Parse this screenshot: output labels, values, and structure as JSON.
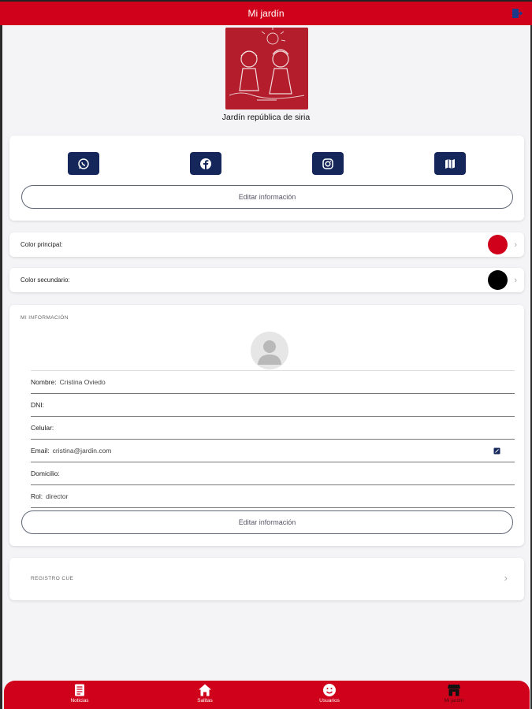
{
  "header": {
    "title": "Mi jardín",
    "logout_icon": "logout-icon"
  },
  "school": {
    "name": "Jardín república de siria",
    "logo_icon": "school-drawing-image"
  },
  "social": {
    "buttons": [
      {
        "icon": "whatsapp-icon"
      },
      {
        "icon": "facebook-icon"
      },
      {
        "icon": "instagram-icon"
      },
      {
        "icon": "map-icon"
      }
    ],
    "edit_label": "Editar información"
  },
  "colors": {
    "primary": {
      "label": "Color principal:",
      "value": "#d0021b"
    },
    "secondary": {
      "label": "Color secundario:",
      "value": "#000000"
    }
  },
  "my_info": {
    "section_label": "Mi información",
    "fields": [
      {
        "label": "Nombre:",
        "value": "Cristina Oviedo"
      },
      {
        "label": "DNI:",
        "value": ""
      },
      {
        "label": "Celular:",
        "value": ""
      },
      {
        "label": "Email:",
        "value": "cristina@jardin.com"
      },
      {
        "label": "Domicilio:",
        "value": ""
      },
      {
        "label": "Rol:",
        "value": "director"
      }
    ],
    "edit_label": "Editar información"
  },
  "registry": {
    "label": "Registro CUE"
  },
  "bottom_nav": {
    "items": [
      {
        "label": "Noticias",
        "icon": "news-icon"
      },
      {
        "label": "Salitas",
        "icon": "home-icon"
      },
      {
        "label": "Usuarios",
        "icon": "users-icon"
      },
      {
        "label": "Mi jardín",
        "icon": "store-icon"
      }
    ]
  },
  "theme": {
    "accent": "#d0021b",
    "button_navy": "#14265a"
  }
}
